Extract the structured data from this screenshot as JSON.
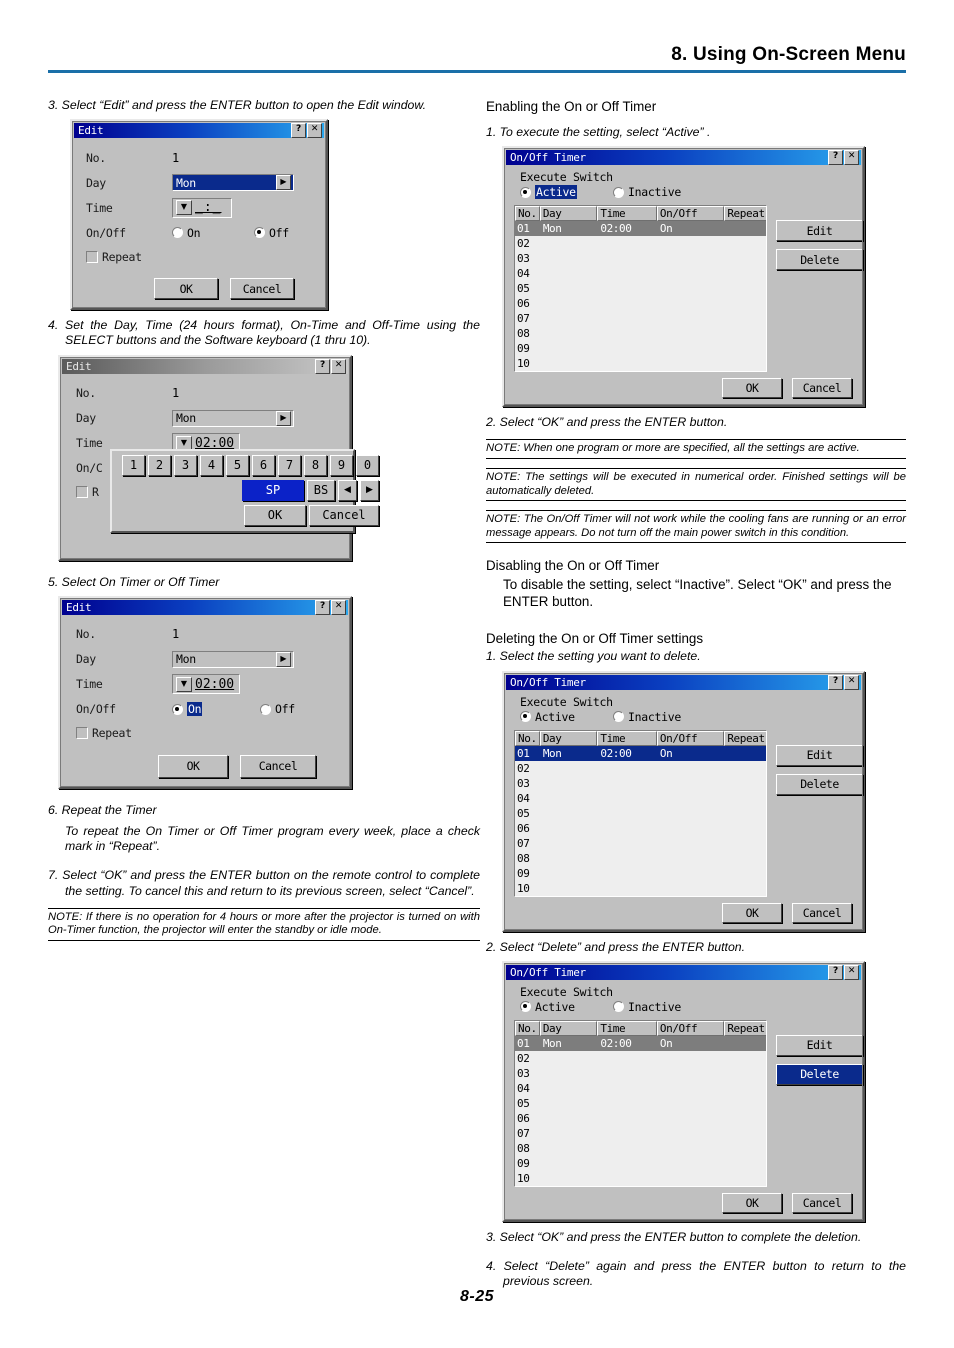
{
  "header": {
    "title": "8. Using On-Screen Menu"
  },
  "footer": {
    "page": "8-25"
  },
  "left": {
    "step3": "3. Select “Edit” and press the ENTER button to open the Edit window.",
    "step4": "4. Set the Day, Time (24 hours format), On-Time and Off-Time using the SELECT buttons and the Software keyboard (1 thru 10).",
    "step5": "5. Select On Timer or Off Timer",
    "step6_title": "6. Repeat the Timer",
    "step6_body": "To repeat the On Timer or Off Timer program every week, place a check mark in “Repeat”.",
    "step7": "7. Select “OK” and press the ENTER button on the remote control to complete the setting. To cancel this and return to its previous screen, select “Cancel”.",
    "note1": "NOTE: If there is no operation for 4 hours or more after the projector is turned on with On-Timer function, the projector will enter the standby or idle mode."
  },
  "right": {
    "enabling_heading": "Enabling the On or Off Timer",
    "enabling_step1": "1. To execute the setting, select “Active” .",
    "enabling_step2": "2. Select “OK” and press the ENTER button.",
    "note1": "NOTE: When one program or more are specified, all the settings are active.",
    "note2": "NOTE: The settings will be executed in numerical order. Finished settings will be automatically deleted.",
    "note3": "NOTE: The On/Off Timer will not work while the cooling fans are running or an error message appears. Do not turn off the main power switch in this condition.",
    "disabling_heading": "Disabling the On or Off Timer",
    "disabling_body": "To disable the setting, select “Inactive”. Select “OK” and press the ENTER button.",
    "deleting_heading": "Deleting the On or Off Timer settings",
    "deleting_step1": "1. Select the setting you want to delete.",
    "deleting_step2": "2. Select “Delete” and press the ENTER button.",
    "deleting_step3": "3. Select “OK” and press the ENTER button to complete the deletion.",
    "deleting_step4": "4. Select “Delete” again and press the ENTER button to return to the previous screen."
  },
  "edit_dialog_1": {
    "title": "Edit",
    "help_btn": "?",
    "close_btn": "✕",
    "labels": {
      "no": "No.",
      "day": "Day",
      "time": "Time",
      "onoff": "On/Off",
      "repeat": "Repeat"
    },
    "no_value": "1",
    "day_value": "Mon",
    "day_spin": "▶",
    "time_dropdown": "▼",
    "time_value": "_:_",
    "radio_on": "On",
    "radio_off": "Off",
    "selected_radio": "Off",
    "ok": "OK",
    "cancel": "Cancel"
  },
  "edit_dialog_2": {
    "title": "Edit",
    "help_btn": "?",
    "close_btn": "✕",
    "labels": {
      "no": "No.",
      "day": "Day",
      "time": "Time",
      "onoff": "On/C",
      "repeat": "R"
    },
    "no_value": "1",
    "day_value": "Mon",
    "day_spin": "▶",
    "time_dropdown": "▼",
    "time_value": "02:00",
    "keyboard": {
      "digits": [
        "1",
        "2",
        "3",
        "4",
        "5",
        "6",
        "7",
        "8",
        "9",
        "0"
      ],
      "sp": "SP",
      "bs": "BS",
      "left": "◀",
      "right": "▶",
      "ok": "OK",
      "cancel": "Cancel",
      "selected_key": "SP"
    }
  },
  "edit_dialog_3": {
    "title": "Edit",
    "help_btn": "?",
    "close_btn": "✕",
    "labels": {
      "no": "No.",
      "day": "Day",
      "time": "Time",
      "onoff": "On/Off",
      "repeat": "Repeat"
    },
    "no_value": "1",
    "day_value": "Mon",
    "day_spin": "▶",
    "time_dropdown": "▼",
    "time_value": "02:00",
    "radio_on": "On",
    "radio_off": "Off",
    "selected_radio": "On",
    "ok": "OK",
    "cancel": "Cancel"
  },
  "timer_dialog_common": {
    "title": "On/Off Timer",
    "help_btn": "?",
    "close_btn": "✕",
    "execute_switch_label": "Execute Switch",
    "active": "Active",
    "inactive": "Inactive",
    "columns": [
      "No.",
      "Day",
      "Time",
      "On/Off",
      "Repeat"
    ],
    "rows": [
      {
        "no": "01",
        "day": "Mon",
        "time": "02:00",
        "onoff": "On",
        "repeat": ""
      },
      {
        "no": "02",
        "day": "",
        "time": "",
        "onoff": "",
        "repeat": ""
      },
      {
        "no": "03",
        "day": "",
        "time": "",
        "onoff": "",
        "repeat": ""
      },
      {
        "no": "04",
        "day": "",
        "time": "",
        "onoff": "",
        "repeat": ""
      },
      {
        "no": "05",
        "day": "",
        "time": "",
        "onoff": "",
        "repeat": ""
      },
      {
        "no": "06",
        "day": "",
        "time": "",
        "onoff": "",
        "repeat": ""
      },
      {
        "no": "07",
        "day": "",
        "time": "",
        "onoff": "",
        "repeat": ""
      },
      {
        "no": "08",
        "day": "",
        "time": "",
        "onoff": "",
        "repeat": ""
      },
      {
        "no": "09",
        "day": "",
        "time": "",
        "onoff": "",
        "repeat": ""
      },
      {
        "no": "10",
        "day": "",
        "time": "",
        "onoff": "",
        "repeat": ""
      }
    ],
    "edit": "Edit",
    "delete": "Delete",
    "ok": "OK",
    "cancel": "Cancel"
  },
  "timer_dialog_1": {
    "selected_radio": "Active",
    "active_highlighted": true,
    "row_selected": "01",
    "row_style": "gray",
    "button_selected": ""
  },
  "timer_dialog_2": {
    "selected_radio": "Active",
    "active_highlighted": false,
    "row_selected": "01",
    "row_style": "blue",
    "button_selected": ""
  },
  "timer_dialog_3": {
    "selected_radio": "Active",
    "active_highlighted": false,
    "row_selected": "01",
    "row_style": "gray",
    "button_selected": "Delete"
  },
  "colors": {
    "header_rule": "#1a6fa8",
    "title_bar_start": "#00008f",
    "title_bar_end": "#2aa8ef",
    "selection_blue": "#0a2a8c",
    "selection_gray": "#7d7d7d",
    "dialog_face": "#c0c0c0"
  }
}
